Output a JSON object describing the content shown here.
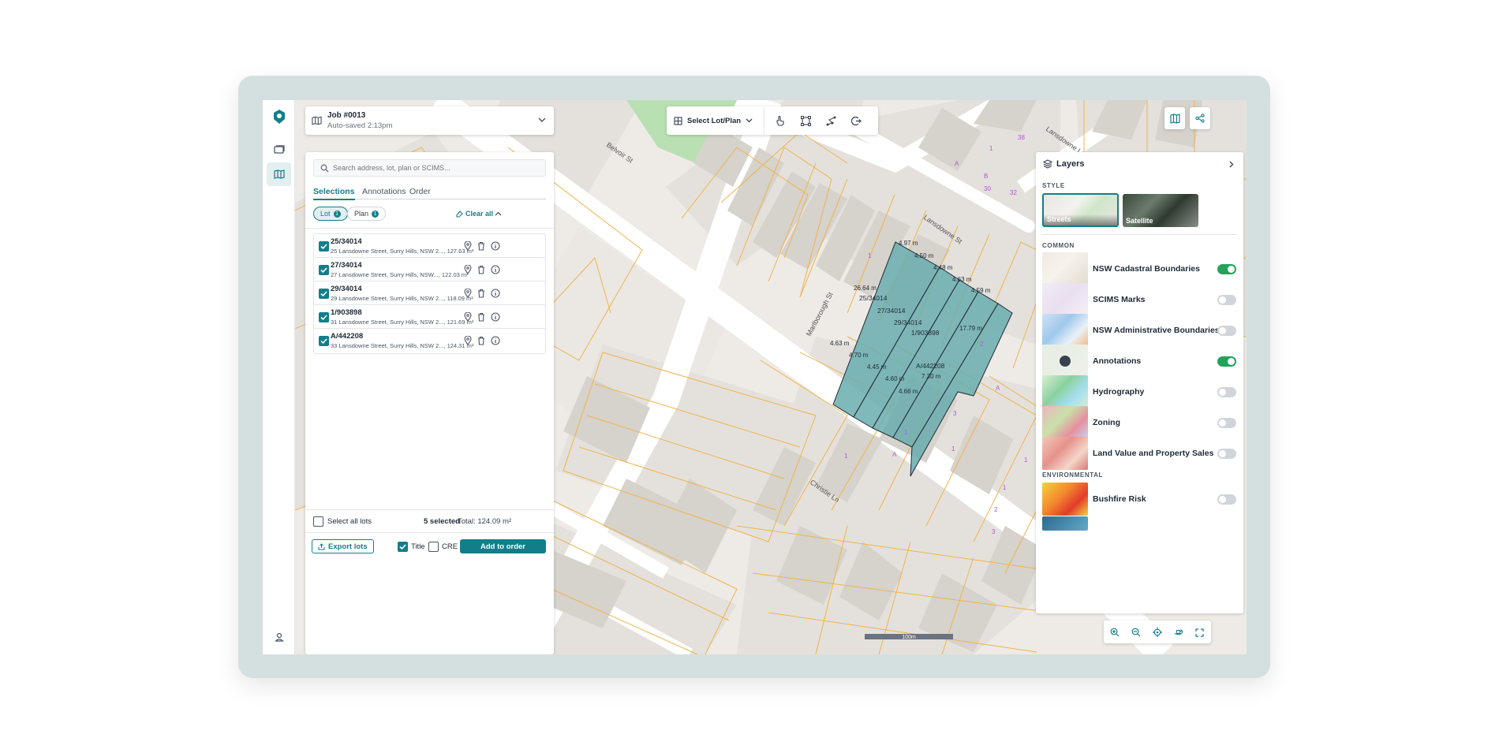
{
  "job": {
    "title": "Job #0013",
    "subtitle": "Auto-saved 2:13pm"
  },
  "search": {
    "placeholder": "Search address, lot, plan or SCIMS..."
  },
  "tabs": [
    {
      "label": "Selections"
    },
    {
      "label": "Annotations"
    },
    {
      "label": "Order"
    }
  ],
  "filters": {
    "lot_label": "Lot",
    "lot_count": "1",
    "plan_label": "Plan",
    "plan_count": "1",
    "clear_all": "Clear all"
  },
  "lots": [
    {
      "id": "25/34014",
      "address": "25 Lansdowne Street, Surry Hills, NSW 2...",
      "area": "127.63 m²"
    },
    {
      "id": "27/34014",
      "address": "27 Lansdowne Street, Surry Hills, NSW...",
      "area": "122.03 m²"
    },
    {
      "id": "29/34014",
      "address": "29 Lansdowne Street, Surry Hills, NSW 2...",
      "area": "118.09 m²"
    },
    {
      "id": "1/903898",
      "address": "31 Lansdowne Street, Surry Hills, NSW 2...",
      "area": "121.69 m²"
    },
    {
      "id": "A/442208",
      "address": "33 Lansdowne Street, Surry Hills, NSW 2...",
      "area": "124.31 m²"
    }
  ],
  "footer": {
    "select_all": "Select all lots",
    "selected": "5 selected",
    "total": "Total: 124.09 m²",
    "export": "Export lots",
    "title_opt": "Title",
    "cre_opt": "CRE",
    "add": "Add to order"
  },
  "toolbar": {
    "select_mode": "Select Lot/Plan"
  },
  "layers": {
    "title": "Layers",
    "style_heading": "STYLE",
    "styles": [
      {
        "label": "Streets"
      },
      {
        "label": "Satellite"
      }
    ],
    "common_heading": "COMMON",
    "common": [
      {
        "name": "NSW Cadastral Boundaries",
        "on": true
      },
      {
        "name": "SCIMS Marks",
        "on": false
      },
      {
        "name": "NSW Administrative Boundaries",
        "on": false
      },
      {
        "name": "Annotations",
        "on": true
      },
      {
        "name": "Hydrography",
        "on": false
      },
      {
        "name": "Zoning",
        "on": false
      },
      {
        "name": "Land Value and Property Sales",
        "on": false
      }
    ],
    "env_heading": "ENVIRONMENTAL",
    "env": [
      {
        "name": "Bushfire Risk",
        "on": false
      }
    ]
  },
  "map": {
    "scale": "100m",
    "streets": [
      "Belvoir St",
      "Lansdowne St",
      "Lansdowne Ln",
      "Marlborough St",
      "Christie Ln"
    ],
    "lot_labels": [
      "25/34014",
      "27/34014",
      "29/34014",
      "1/903898",
      "A/442208"
    ],
    "dims": [
      "4.97 m",
      "4.50 m",
      "4.48 m",
      "4.63 m",
      "4.59 m",
      "26.64 m",
      "17.79 m",
      "4.63 m",
      "4.70 m",
      "4.45 m",
      "4.60 m",
      "4.66 m",
      "7.30 m"
    ],
    "parcel_numbers": [
      "1",
      "1",
      "38",
      "B",
      "A",
      "30",
      "32",
      "1",
      "21",
      "3",
      "1",
      "2",
      "B",
      "A",
      "1",
      "1",
      "3",
      "1",
      "1",
      "A",
      "1",
      "1",
      "1",
      "2",
      "3",
      "1"
    ]
  },
  "colors": {
    "accent": "#137e8a",
    "selection_fill": "#6aadae",
    "parcel_line": "#f0b34a",
    "toggle_on": "#22a35a"
  }
}
